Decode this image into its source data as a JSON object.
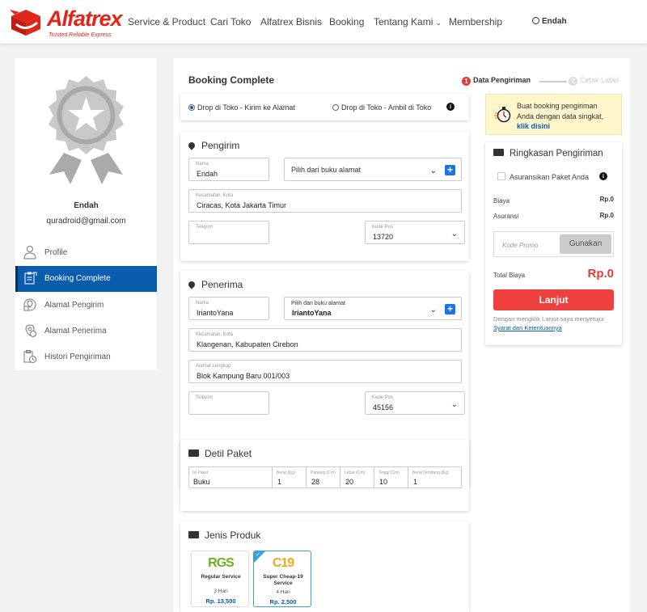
{
  "header": {
    "brand": "Alfatrex",
    "tagline": "Trusted Reliable Express",
    "nav": [
      "Service & Product",
      "Cari Toko",
      "Alfatrex Bisnis",
      "Booking",
      "Tentang Kami",
      "Membership"
    ],
    "user": "Endah"
  },
  "sidebar": {
    "name": "Endah",
    "email": "quradroid@gmail.com",
    "items": [
      {
        "label": "Profile"
      },
      {
        "label": "Booking Complete"
      },
      {
        "label": "Alamat Pengirim"
      },
      {
        "label": "Alamat Penerima"
      },
      {
        "label": "Histori Pengiriman"
      }
    ]
  },
  "page": {
    "title": "Booking Complete",
    "steps": [
      {
        "num": "1",
        "label": "Data Pengiriman"
      },
      {
        "num": "2",
        "label": "Cetak Label"
      }
    ]
  },
  "delivery": {
    "option1": "Drop di Toko - Kirim ke Alamat",
    "option2": "Drop di Toko - Ambil di Toko",
    "selected": "option1"
  },
  "pengirim": {
    "title": "Pengirim",
    "name_label": "Nama",
    "name_value": "Endah",
    "book_placeholder": "Pilih dari buku alamat",
    "district_label": "Kecamatan, Kota",
    "district_value": "Ciracas, Kota Jakarta Timur",
    "phone_label": "Telepon",
    "phone_value": "",
    "postal_label": "Kode Pos",
    "postal_value": "13720"
  },
  "penerima": {
    "title": "Penerima",
    "name_label": "Nama",
    "name_value": "IriantoYana",
    "book_label": "Pilih dari buku alamat",
    "book_value": "IriantoYana",
    "district_label": "Kecamatan, Kota",
    "district_value": "Klangenan, Kabupaten Cirebon",
    "address_label": "Alamat Lengkap",
    "address_value": "Blok Kampung Baru 001/003",
    "phone_label": "Telepon",
    "phone_value": "",
    "postal_label": "Kode Pos",
    "postal_value": "45156"
  },
  "paket": {
    "title": "Detil Paket",
    "fields": [
      {
        "label": "Isi Paket",
        "value": "Buku"
      },
      {
        "label": "Berat (Kg)",
        "value": "1"
      },
      {
        "label": "Panjang (Cm)",
        "value": "28"
      },
      {
        "label": "Lebar (Cm)",
        "value": "20"
      },
      {
        "label": "Tinggi (Cm)",
        "value": "10"
      },
      {
        "label": "Berat Terhitung (Kg)",
        "value": "1"
      }
    ]
  },
  "produk": {
    "title": "Jenis Produk",
    "items": [
      {
        "code": "RGS",
        "name": "Regular Service",
        "days": "3 Hari",
        "price": "Rp. 13,500",
        "color": "#6ab023"
      },
      {
        "code": "C19",
        "name": "Super Cheap-19 Service",
        "days": "4 Hari",
        "price": "Rp. 2,500",
        "color": "#f5a623"
      }
    ]
  },
  "promo": {
    "line1": "Buat booking pengiriman",
    "line2": "Anda dengan data singkat,",
    "link": "klik disini"
  },
  "summary": {
    "title": "Ringkasan Pengiriman",
    "insurance_label": "Asuransikan Paket Anda",
    "biaya_label": "Biaya",
    "biaya_value": "Rp.0",
    "asuransi_label": "Asuransi",
    "asuransi_value": "Rp.0",
    "promo_placeholder": "Kode Promo",
    "promo_button": "Gunakan",
    "total_label": "Total Biaya",
    "total_value": "Rp.0",
    "submit": "Lanjut",
    "terms_text": "Dengan mengklik Lanjut saya menyetujui",
    "terms_link": "Syarat dan Ketentuannya"
  },
  "colors": {
    "brand": "#e1251b",
    "primary": "#0a5dad",
    "cta": "#ef4040"
  }
}
